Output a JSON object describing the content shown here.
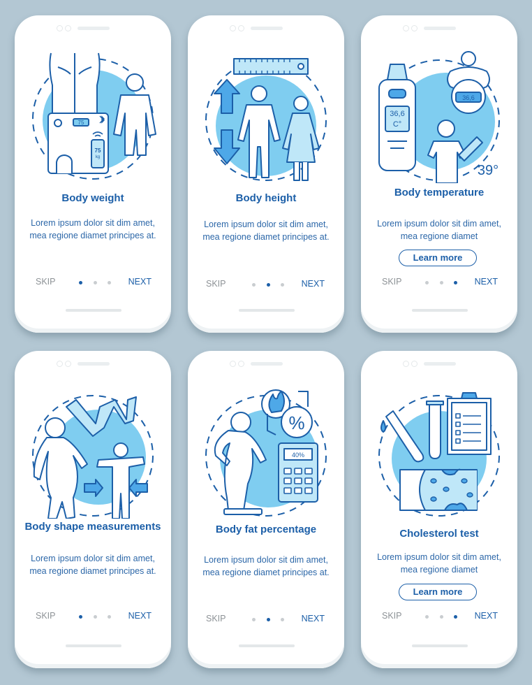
{
  "colors": {
    "background": "#b3c7d3",
    "accent": "#1c5fa8",
    "illustration_fill": "#7fcdf0",
    "muted_text": "#8d9296"
  },
  "screens": [
    {
      "title": "Body weight",
      "description": "Lorem ipsum dolor sit dim amet, mea regione diamet principes at.",
      "skip_label": "SKIP",
      "next_label": "NEXT",
      "active_dot": 1,
      "dot_count": 3,
      "illustration": "body-weight-scale-illustration",
      "illustration_text": {
        "scale_display": "75",
        "phone_value": "75",
        "phone_unit": "kg"
      }
    },
    {
      "title": "Body height",
      "description": "Lorem ipsum dolor sit dim amet, mea regione diamet principes at.",
      "skip_label": "SKIP",
      "next_label": "NEXT",
      "active_dot": 2,
      "dot_count": 3,
      "illustration": "body-height-ruler-illustration"
    },
    {
      "title": "Body temperature",
      "description": "Lorem ipsum dolor sit dim amet, mea regione diamet",
      "learn_more_label": "Learn more",
      "skip_label": "SKIP",
      "next_label": "NEXT",
      "active_dot": 3,
      "dot_count": 3,
      "illustration": "thermometer-illustration",
      "illustration_text": {
        "thermometer_value": "36,6",
        "thermometer_unit": "C°",
        "pacifier_value": "36,6",
        "fever_value": "39°"
      }
    },
    {
      "title": "Body shape measurements",
      "description": "Lorem ipsum dolor sit dim amet, mea regione diamet principes at.",
      "skip_label": "SKIP",
      "next_label": "NEXT",
      "active_dot": 1,
      "dot_count": 3,
      "illustration": "measuring-tape-illustration"
    },
    {
      "title": "Body fat percentage",
      "description": "Lorem ipsum dolor sit dim amet, mea regione diamet principes at.",
      "skip_label": "SKIP",
      "next_label": "NEXT",
      "active_dot": 2,
      "dot_count": 3,
      "illustration": "fat-calculator-illustration",
      "illustration_text": {
        "calculator_display": "40%",
        "percent_symbol": "%"
      }
    },
    {
      "title": "Cholesterol test",
      "description": "Lorem ipsum dolor sit dim amet, mea regione diamet",
      "learn_more_label": "Learn more",
      "skip_label": "SKIP",
      "next_label": "NEXT",
      "active_dot": 3,
      "dot_count": 3,
      "illustration": "cholesterol-test-illustration"
    }
  ]
}
